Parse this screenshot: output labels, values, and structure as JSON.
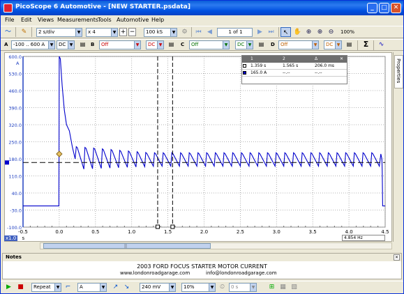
{
  "window": {
    "title": "PicoScope 6 Automotive - [NEW STARTER.psdata]",
    "min_glyph": "_",
    "max_glyph": "□",
    "close_glyph": "✕"
  },
  "menu": [
    "File",
    "Edit",
    "Views",
    "Measurements",
    "Tools",
    "Automotive",
    "Help"
  ],
  "toolbar": {
    "timebase": "2 s/div",
    "zoom": "x 4",
    "samples": "100 kS",
    "page": "1 of 1",
    "zoom_pct": "100%"
  },
  "channels": [
    {
      "letter": "A",
      "range": "-100 .. 600 A",
      "coupling": "DC",
      "probe": "",
      "color": "#0000cc"
    },
    {
      "letter": "B",
      "range": "Off",
      "coupling": "DC",
      "color": "#cc0000"
    },
    {
      "letter": "C",
      "range": "Off",
      "coupling": "DC",
      "color": "#008000"
    },
    {
      "letter": "D",
      "range": "Off",
      "coupling": "DC",
      "color": "#d4a000"
    }
  ],
  "sigma_glyph": "Σ",
  "properties_tab": "Properties",
  "measurements": {
    "headers": [
      "1",
      "2",
      "Δ"
    ],
    "rows": [
      {
        "c1": "1.359 s",
        "c2": "1.565 s",
        "delta": "206.0 ms"
      },
      {
        "c1": "165.0 A",
        "c2": "--.--",
        "delta": "--.--"
      }
    ]
  },
  "chart_data": {
    "type": "line",
    "xlabel": "s",
    "x_ticks": [
      "-0.5",
      "0.0",
      "0.5",
      "1.0",
      "1.5",
      "2.0",
      "2.5",
      "3.0",
      "3.5",
      "4.0",
      "4.5"
    ],
    "y_ticks": [
      "600.0",
      "530.0",
      "460.0",
      "390.0",
      "320.0",
      "250.0",
      "180.0",
      "110.0",
      "40.0",
      "-30.0",
      "-100.0"
    ],
    "y_top_label": "A",
    "xlim": [
      -0.5,
      4.5
    ],
    "ylim": [
      -100,
      600
    ],
    "grid": true,
    "series": [
      {
        "color": "#0000cc"
      }
    ],
    "cursor_x": [
      1.359,
      1.565
    ],
    "cursor_y": 165.0,
    "trigger": {
      "x": 0.0,
      "y": 200.0
    }
  },
  "zoom_readout": "x1.0",
  "freq_readout": "4.854 Hz",
  "notes": {
    "header": "Notes",
    "line1": "2003 FORD FOCUS STARTER MOTOR CURRENT",
    "site": "www.londonroadgarage.com",
    "email": "info@londonroadgarage.com"
  },
  "status": {
    "trigger_mode": "Repeat",
    "trigger_channel": "A",
    "threshold": "240 mV",
    "pretrigger": "10%",
    "delay": "0 s"
  }
}
